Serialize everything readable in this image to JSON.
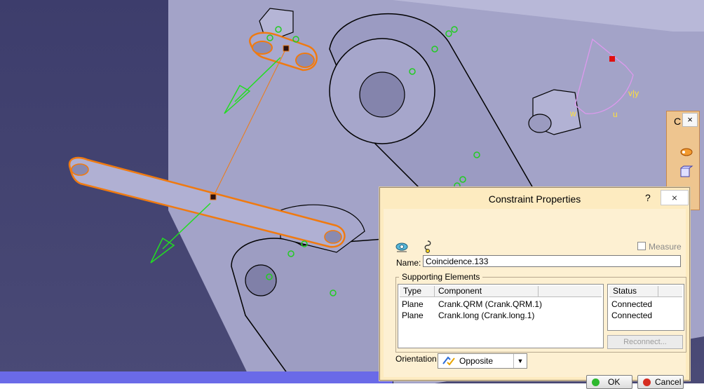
{
  "viewport": {
    "axis_labels": [
      "v|y",
      "u",
      "w"
    ]
  },
  "toolbox": {
    "title": "C",
    "close_glyph": "×",
    "icons": [
      "constraint-icon",
      "cube-icon",
      "cube-small-icon"
    ]
  },
  "dialog": {
    "title": "Constraint Properties",
    "help_glyph": "?",
    "close_glyph": "×",
    "icons": [
      "coincidence-constraint-icon",
      "orientation-icon"
    ],
    "measure_label": "Measure",
    "measure_checked": false,
    "name_label": "Name:",
    "name_value": "Coincidence.133",
    "supporting_elements_label": "Supporting Elements",
    "columns": [
      "Type",
      "Component",
      "Status"
    ],
    "rows": [
      {
        "type": "Plane",
        "component": "Crank.QRM (Crank.QRM.1)",
        "status": "Connected"
      },
      {
        "type": "Plane",
        "component": "Crank.long (Crank.long.1)",
        "status": "Connected"
      }
    ],
    "reconnect_label": "Reconnect...",
    "orientation_label": "Orientation",
    "orientation_value": "Opposite",
    "ok_label": "OK",
    "cancel_label": "Cancel",
    "colors": {
      "ok_dot": "#2eb82e",
      "cancel_dot": "#d62d20",
      "dialog_bg": "#fdebc0"
    }
  }
}
